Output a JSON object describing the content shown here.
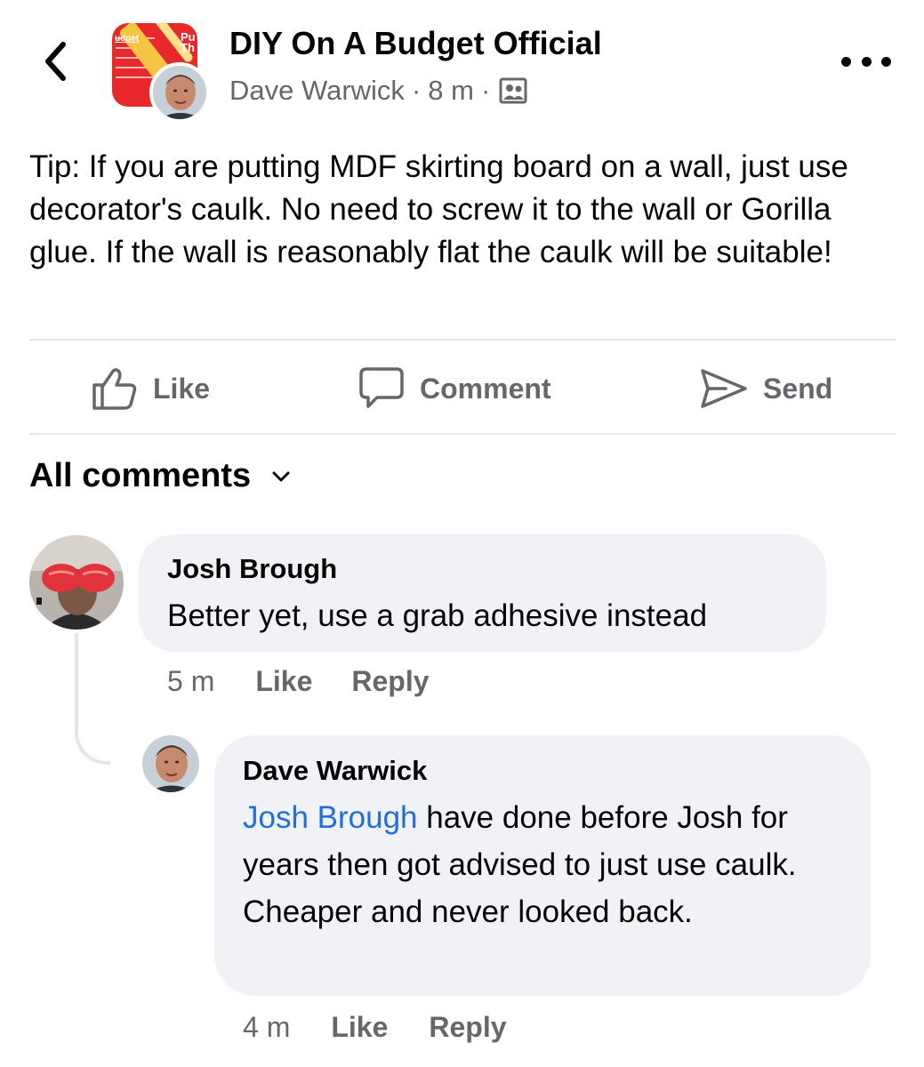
{
  "header": {
    "group_name": "DIY On A Budget Official",
    "author": "Dave Warwick",
    "separator": "·",
    "time": "8 m",
    "group_avatar_text_left": "udget",
    "group_avatar_text_right": "Pu Th",
    "more_label": "•••"
  },
  "post": {
    "text": "Tip: If you are putting MDF skirting board on a wall, just use decorator's caulk. No need to screw it to the wall or Gorilla glue. If the wall is reasonably flat the caulk will be suitable!"
  },
  "actions": {
    "like": "Like",
    "comment": "Comment",
    "send": "Send"
  },
  "comments_header": {
    "label": "All comments"
  },
  "comments": [
    {
      "name": "Josh Brough",
      "text": "Better yet, use a grab adhesive instead",
      "time": "5 m",
      "like": "Like",
      "reply": "Reply"
    },
    {
      "name": "Dave Warwick",
      "mention": "Josh Brough",
      "text": " have done before Josh for years then got advised to just use caulk. Cheaper and never looked back.",
      "time": "4 m",
      "like": "Like",
      "reply": "Reply"
    }
  ],
  "colors": {
    "text_primary": "#050505",
    "text_secondary": "#65676b",
    "bubble_bg": "#f0f2f5",
    "mention_link": "#216fdb",
    "divider": "#e4e6eb",
    "group_avatar_bg": "#e8282b"
  },
  "icons": [
    "back-chevron-icon",
    "members-icon",
    "more-dots-icon",
    "thumbs-up-icon",
    "comment-icon",
    "send-icon",
    "chevron-down-icon"
  ]
}
